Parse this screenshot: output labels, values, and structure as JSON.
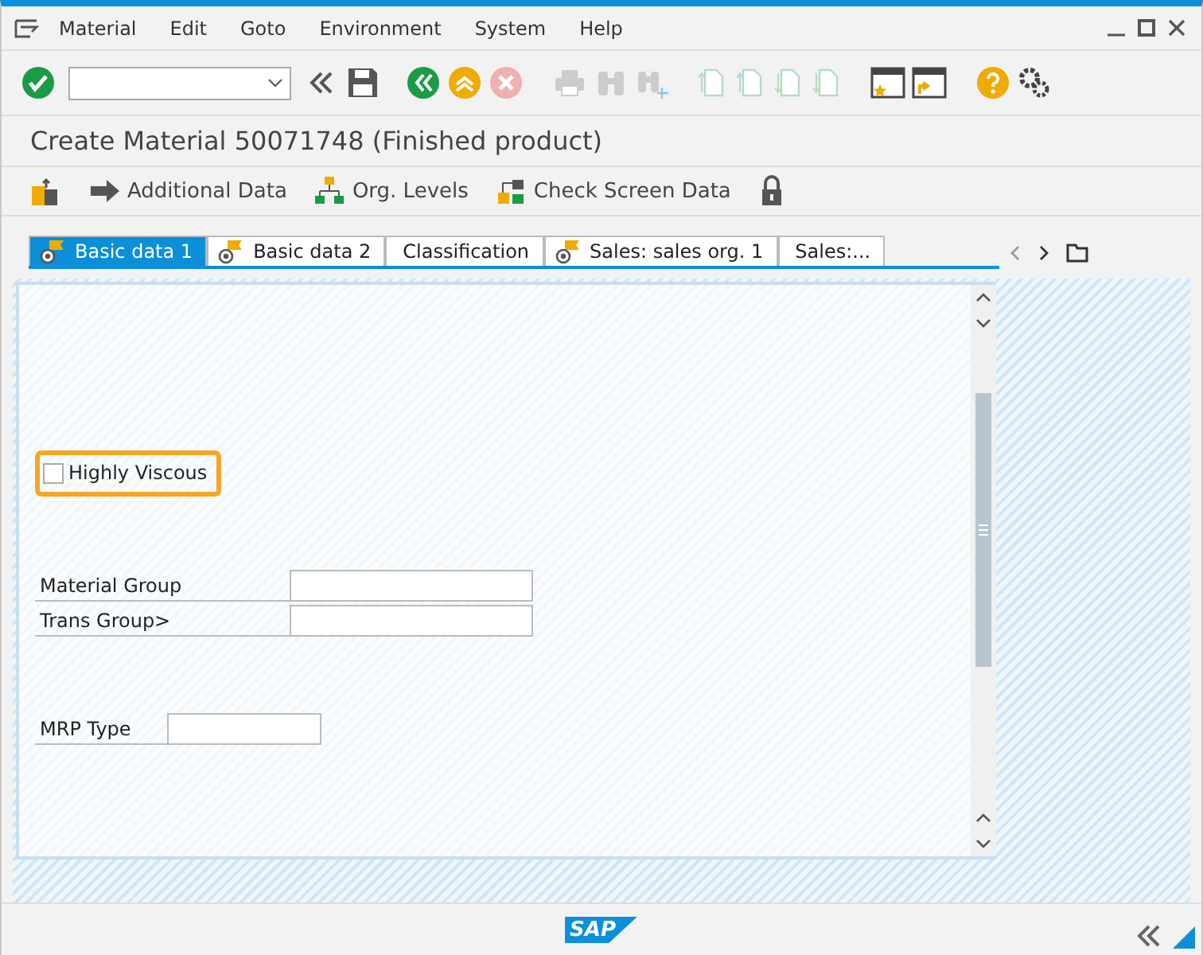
{
  "menu": [
    "Material",
    "Edit",
    "Goto",
    "Environment",
    "System",
    "Help"
  ],
  "toolbar": [
    {
      "kind": "enter",
      "disabled": false
    },
    {
      "kind": "command"
    },
    {
      "kind": "back-chevrons",
      "disabled": false
    },
    {
      "kind": "save",
      "disabled": false
    },
    {
      "kind": "back",
      "disabled": false
    },
    {
      "kind": "exit",
      "disabled": false
    },
    {
      "kind": "cancel",
      "disabled": true
    },
    {
      "kind": "print",
      "disabled": true
    },
    {
      "kind": "find",
      "disabled": true
    },
    {
      "kind": "find-next",
      "disabled": true
    },
    {
      "kind": "first-page",
      "disabled": true
    },
    {
      "kind": "prev-page",
      "disabled": true
    },
    {
      "kind": "next-page",
      "disabled": true
    },
    {
      "kind": "last-page",
      "disabled": true
    },
    {
      "kind": "new-session",
      "disabled": false
    },
    {
      "kind": "shortcut",
      "disabled": false
    },
    {
      "kind": "help",
      "disabled": false
    },
    {
      "kind": "settings",
      "disabled": false
    }
  ],
  "title": "Create Material 50071748 (Finished product)",
  "app_toolbar": [
    {
      "kind": "select-views"
    },
    {
      "kind": "arrow",
      "label": "Additional Data"
    },
    {
      "kind": "hierarchy",
      "label": "Org. Levels"
    },
    {
      "kind": "check",
      "label": "Check Screen Data"
    },
    {
      "kind": "lock"
    }
  ],
  "tabs": [
    {
      "label": "Basic data 1",
      "selected": true,
      "kind": "flagged"
    },
    {
      "label": "Basic data 2",
      "selected": false,
      "kind": "flagged"
    },
    {
      "label": "Classification",
      "selected": false,
      "kind": "plain"
    },
    {
      "label": "Sales: sales org. 1",
      "selected": false,
      "kind": "flagged"
    },
    {
      "label": "Sales:...",
      "selected": false,
      "kind": "plain"
    }
  ],
  "checkbox": {
    "label": "Highly Viscous",
    "checked": false,
    "highlighted": true
  },
  "fields": [
    {
      "label": "Material Group",
      "kind": "wide"
    },
    {
      "label": "Trans Group>",
      "kind": "wide"
    },
    {
      "label": "MRP Type",
      "kind": "short"
    }
  ],
  "status_bar": {
    "logo": "SAP"
  }
}
